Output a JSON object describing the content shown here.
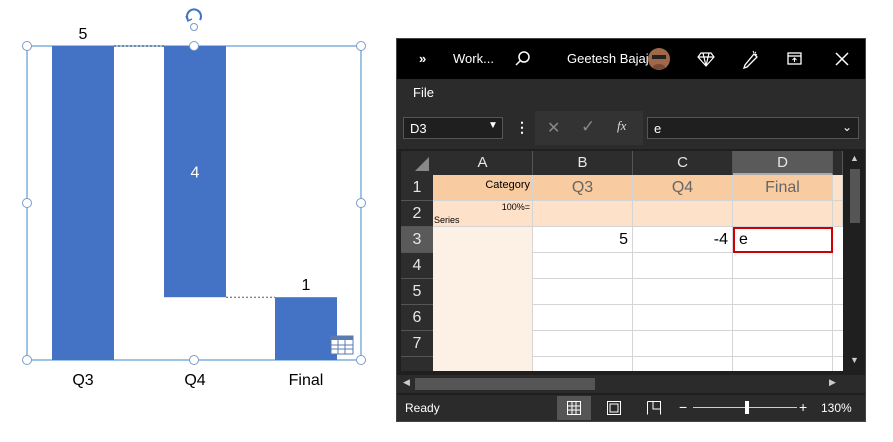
{
  "chart_data": {
    "type": "bar",
    "categories": [
      "Q3",
      "Q4",
      "Final"
    ],
    "values": [
      5,
      -4,
      1
    ],
    "data_labels": [
      "5",
      "4",
      "1"
    ],
    "title": "",
    "xlabel": "",
    "ylabel": "",
    "ylim": [
      0,
      5
    ],
    "grid": false,
    "legend": "none",
    "bar_color": "#4472c4"
  },
  "excel": {
    "title": "Work...",
    "user": "Geetesh Bajaj",
    "menu_file": "File",
    "namebox": "D3",
    "formula": "e",
    "fx_label": "fx",
    "columns": [
      "A",
      "B",
      "C",
      "D"
    ],
    "rows": [
      "1",
      "2",
      "3",
      "4",
      "5",
      "6",
      "7"
    ],
    "cells": {
      "a1": "Category",
      "a2": "100%=",
      "a2_series": "Series",
      "b1": "Q3",
      "c1": "Q4",
      "d1": "Final",
      "b3": "5",
      "c3": "-4",
      "d3": "e"
    },
    "status_ready": "Ready",
    "zoom": "130%",
    "colors": {
      "header_fill": "#f8cba0",
      "light_fill": "#fde1c8",
      "pale_fill": "#fdf0e4",
      "selection": "#d00000"
    }
  }
}
